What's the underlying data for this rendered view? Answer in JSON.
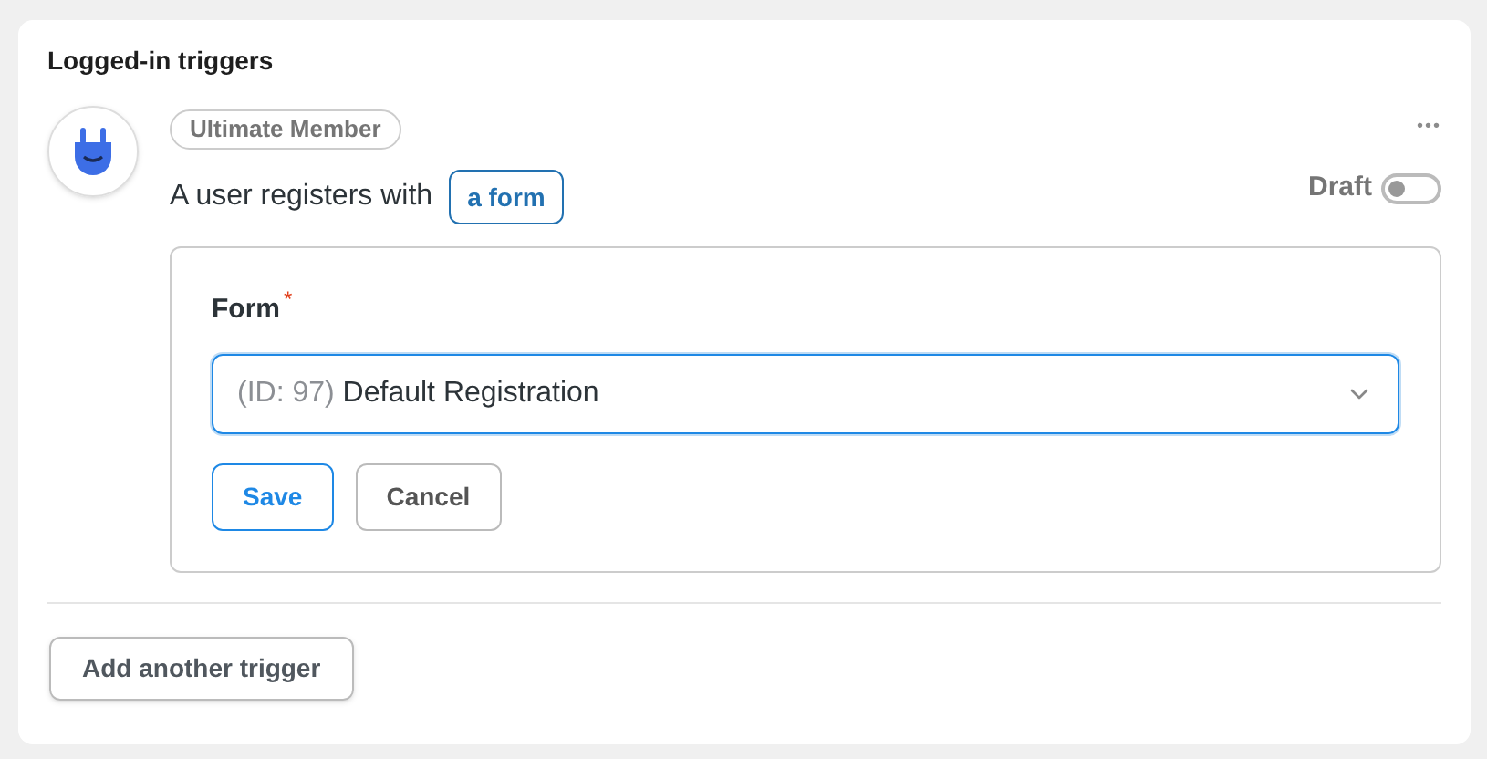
{
  "section_title": "Logged-in triggers",
  "trigger": {
    "integration": "Ultimate Member",
    "sentence": "A user registers with",
    "token": "a form",
    "more": "•••",
    "status": {
      "label": "Draft",
      "on": false
    }
  },
  "form": {
    "label": "Form",
    "required": true,
    "required_mark": "*",
    "select": {
      "prefix": "(ID: 97)",
      "value": "Default Registration"
    },
    "buttons": [
      {
        "label": "Save",
        "kind": "primary"
      },
      {
        "label": "Cancel",
        "kind": "secondary"
      }
    ]
  },
  "add_button": "Add another trigger"
}
